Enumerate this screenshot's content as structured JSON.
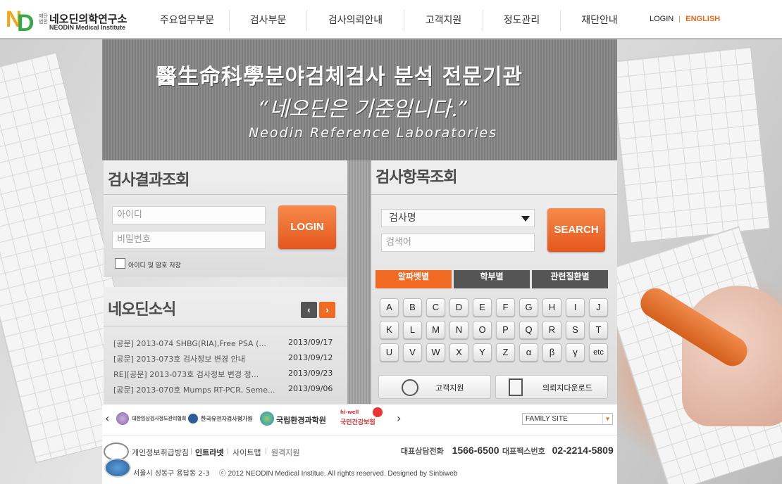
{
  "header": {
    "logo_sub": "재단법인",
    "logo_ko": "네오딘의학연구소",
    "logo_en": "NEODIN Medical Institute",
    "nav": [
      "주요업무부문",
      "검사부문",
      "검사의뢰안내",
      "고객지원",
      "정도관리",
      "재단안내"
    ],
    "login": "LOGIN",
    "english": "ENGLISH"
  },
  "hero": {
    "line1": "醫生命科學분야검체검사 분석 전문기관",
    "line2": "“네오딘은 기준입니다.”",
    "line3": "Neodin Reference Laboratories"
  },
  "results": {
    "title": "검사결과조회",
    "id_placeholder": "아이디",
    "pw_placeholder": "비밀번호",
    "login_button": "LOGIN",
    "remember_label": "아이디 및 암호 저장"
  },
  "news": {
    "title": "네오딘소식",
    "prev": "‹",
    "next": "›",
    "items": [
      {
        "title": "[공문] 2013-074 SHBG(RIA),Free PSA (...",
        "date": "2013/09/17"
      },
      {
        "title": "[공문] 2013-073호 검사정보 변경 안내",
        "date": "2013/09/12"
      },
      {
        "title": "RE][공문] 2013-073호 검사정보 변경 정...",
        "date": "2013/09/23"
      },
      {
        "title": "[공문] 2013-070호 Mumps RT-PCR, Seme...",
        "date": "2013/09/06"
      }
    ]
  },
  "items": {
    "title": "검사항목조회",
    "select_value": "검사명",
    "search_placeholder": "검색어",
    "search_button": "SEARCH",
    "tabs": [
      "알파벳별",
      "학부별",
      "관련질환별"
    ],
    "keys": [
      [
        "A",
        "B",
        "C",
        "D",
        "E",
        "F",
        "G",
        "H",
        "I",
        "J"
      ],
      [
        "K",
        "L",
        "M",
        "N",
        "O",
        "P",
        "Q",
        "R",
        "S",
        "T"
      ],
      [
        "U",
        "V",
        "W",
        "X",
        "Y",
        "Z",
        "α",
        "β",
        "γ",
        "etc"
      ]
    ],
    "customer_support": "고객지원",
    "request_download": "의뢰지다운로드"
  },
  "banner": {
    "prev": "‹",
    "next": "›",
    "org1": "대한임상검사정도관리협회",
    "org2": "한국유전자검사평가원",
    "org3": "국립환경과학원",
    "org4": "국민건강보험",
    "org4_sub": "hi-well",
    "family_site": "FAMILY SITE"
  },
  "footer": {
    "links": [
      "개인정보취급방침",
      "인트라넷",
      "사이트맵",
      "원격지원"
    ],
    "tel_label": "대표상담전화",
    "tel": "1566-6500",
    "fax_label": "대표팩스번호",
    "fax": "02-2214-5809",
    "address": "서울시 성동구 용답동 2-3",
    "copyright": "ⓒ 2012 NEODIN Medical Institue. All rights reserved.  Designed by Sinbiweb"
  },
  "colors": {
    "accent": "#f06a24",
    "tab_active": "#f06a24",
    "tab_inactive": "#555555"
  }
}
